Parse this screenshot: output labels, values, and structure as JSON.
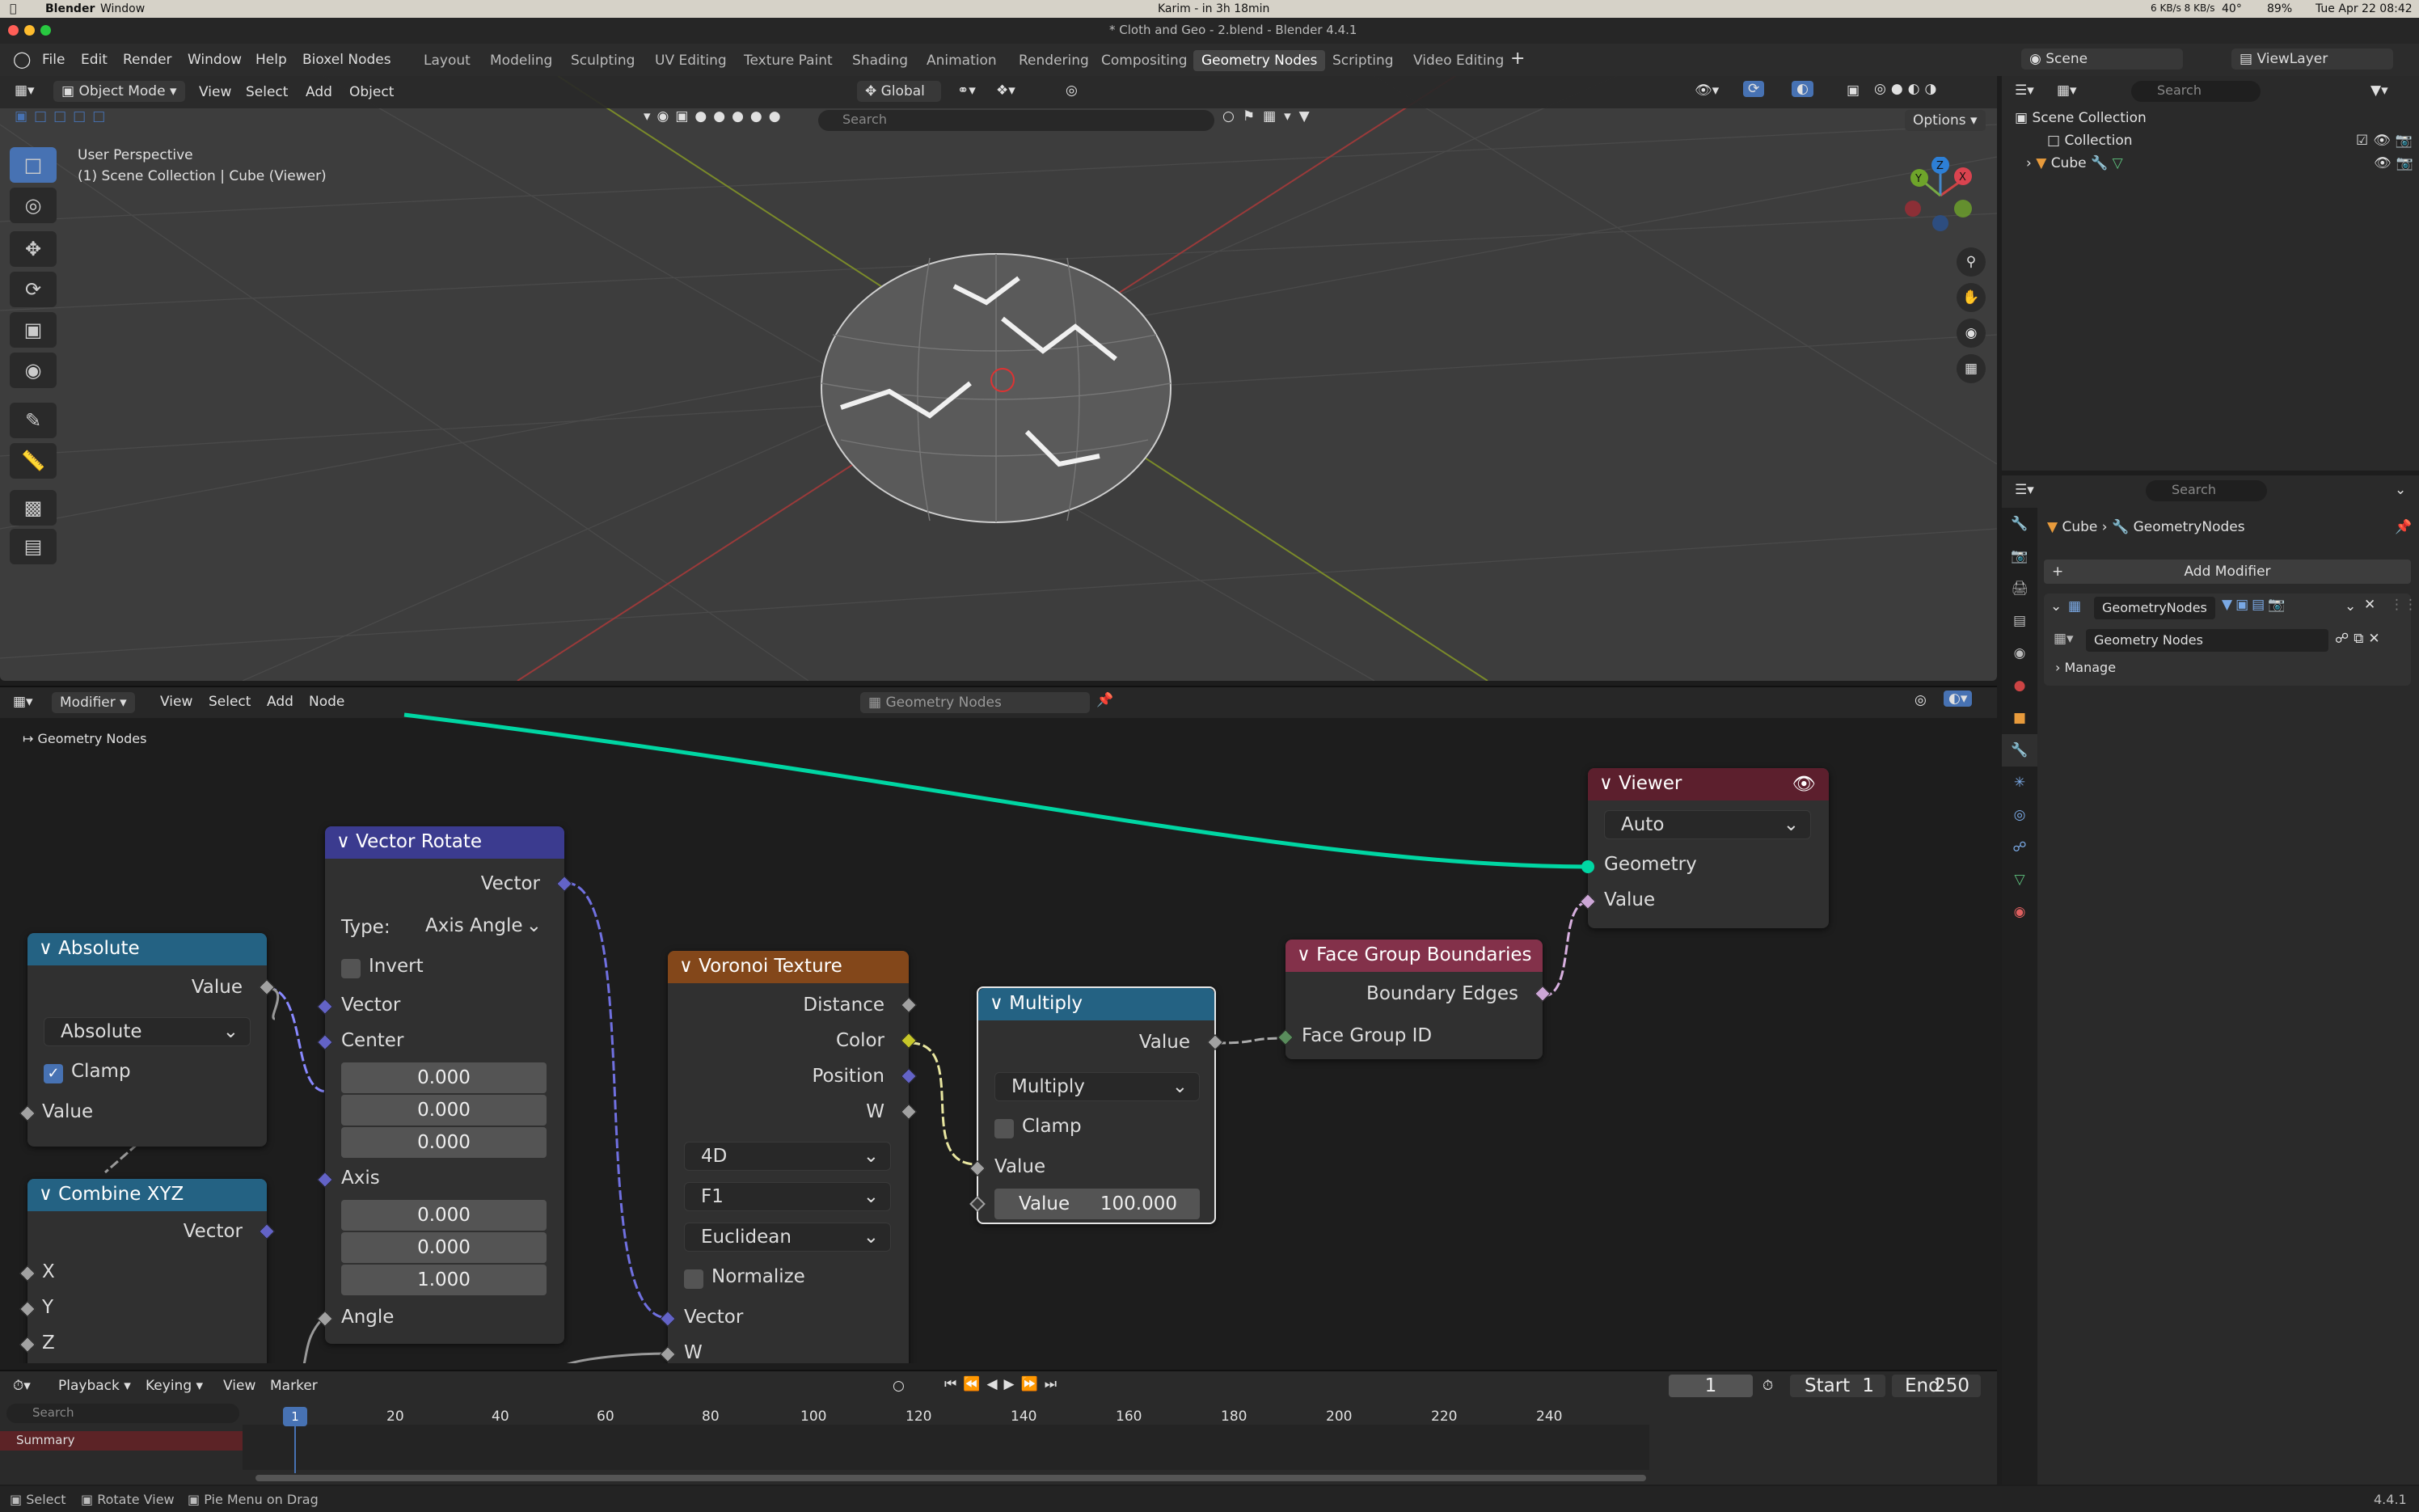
{
  "mac_menubar": {
    "app": "Blender",
    "menu_window": "Window",
    "center_status": "Karim - in 3h 18min",
    "speed": "6 KB/s 8 KB/s",
    "temp": "40°",
    "battery": "89%",
    "datetime": "Tue Apr 22  08:42"
  },
  "window_title": "* Cloth and Geo - 2.blend - Blender 4.4.1",
  "menus": [
    "File",
    "Edit",
    "Render",
    "Window",
    "Help",
    "Bioxel Nodes"
  ],
  "workspaces": [
    "Layout",
    "Modeling",
    "Sculpting",
    "UV Editing",
    "Texture Paint",
    "Shading",
    "Animation",
    "Rendering",
    "Compositing",
    "Geometry Nodes",
    "Scripting",
    "Video Editing"
  ],
  "active_workspace": "Geometry Nodes",
  "scene": {
    "label": "Scene",
    "view_layer": "ViewLayer"
  },
  "viewport": {
    "mode": "Object Mode",
    "menus": [
      "View",
      "Select",
      "Add",
      "Object"
    ],
    "transform": "Global",
    "search_placeholder": "Search",
    "options": "Options",
    "overlay_line1": "User Perspective",
    "overlay_line2": "(1) Scene Collection | Cube (Viewer)",
    "gizmo": {
      "x": "X",
      "y": "Y",
      "z": "Z"
    }
  },
  "outliner": {
    "search_placeholder": "Search",
    "root": "Scene Collection",
    "collection": "Collection",
    "object": "Cube"
  },
  "properties": {
    "search_placeholder": "Search",
    "breadcrumb_obj": "Cube",
    "breadcrumb_mod": "GeometryNodes",
    "add_modifier": "Add Modifier",
    "modifier_name": "GeometryNodes",
    "node_group": "Geometry Nodes",
    "manage": "Manage"
  },
  "node_editor": {
    "type": "Modifier",
    "menus": [
      "View",
      "Select",
      "Add",
      "Node"
    ],
    "tree_name": "Geometry Nodes",
    "breadcrumb": "Geometry Nodes"
  },
  "nodes": {
    "absolute": {
      "title": "Absolute",
      "out": "Value",
      "op": "Absolute",
      "clamp": "Clamp",
      "in": "Value"
    },
    "combine": {
      "title": "Combine XYZ",
      "out": "Vector",
      "x": "X",
      "y": "Y",
      "z": "Z"
    },
    "rotate": {
      "title": "Vector Rotate",
      "out": "Vector",
      "type_label": "Type:",
      "type_val": "Axis Angle",
      "invert": "Invert",
      "vector": "Vector",
      "center": "Center",
      "c1": "0.000",
      "c2": "0.000",
      "c3": "0.000",
      "axis": "Axis",
      "a1": "0.000",
      "a2": "0.000",
      "a3": "1.000",
      "angle": "Angle"
    },
    "voronoi": {
      "title": "Voronoi Texture",
      "distance": "Distance",
      "color": "Color",
      "position": "Position",
      "w_out": "W",
      "dim": "4D",
      "feature": "F1",
      "metric": "Euclidean",
      "normalize": "Normalize",
      "vector": "Vector",
      "w_in": "W"
    },
    "multiply": {
      "title": "Multiply",
      "out": "Value",
      "op": "Multiply",
      "clamp": "Clamp",
      "in": "Value",
      "field_label": "Value",
      "field_val": "100.000"
    },
    "fgb": {
      "title": "Face Group Boundaries",
      "out": "Boundary Edges",
      "in": "Face Group ID"
    },
    "viewer": {
      "title": "Viewer",
      "mode": "Auto",
      "geometry": "Geometry",
      "value": "Value"
    }
  },
  "timeline": {
    "menus": [
      "Playback",
      "Keying",
      "View",
      "Marker"
    ],
    "current_frame": "1",
    "start_label": "Start",
    "start": "1",
    "end_label": "End",
    "end": "250",
    "search_placeholder": "Search",
    "summary": "Summary",
    "ticks": [
      "1",
      "20",
      "40",
      "60",
      "80",
      "100",
      "120",
      "140",
      "160",
      "180",
      "200",
      "220",
      "240"
    ]
  },
  "statusbar": {
    "select": "Select",
    "rotate": "Rotate View",
    "pie": "Pie Menu on Drag",
    "version": "4.4.1"
  },
  "colors": {
    "accent": "#4772b3",
    "link_geometry": "#00d6a3",
    "hdr_absolute": "#246283",
    "hdr_rotate": "#3b3b8f",
    "hdr_voronoi": "#83471a",
    "hdr_fgb": "#83314a",
    "hdr_viewer": "#5c1f2d"
  }
}
